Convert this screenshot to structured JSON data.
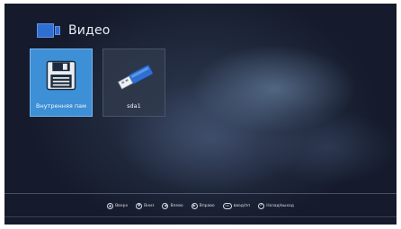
{
  "header": {
    "title": "Видео",
    "icon": "video-folder-icon"
  },
  "sources": [
    {
      "label": "Внутренняя пам",
      "icon": "floppy-disk-icon",
      "selected": true
    },
    {
      "label": "sda1",
      "icon": "usb-drive-icon",
      "selected": false
    }
  ],
  "footer": {
    "hints": [
      {
        "icon": "arrow-up-icon",
        "glyph": "▲",
        "label": "Вверх"
      },
      {
        "icon": "arrow-down-icon",
        "glyph": "▼",
        "label": "Вниз"
      },
      {
        "icon": "arrow-left-icon",
        "glyph": "◀",
        "label": "Влево"
      },
      {
        "icon": "arrow-right-icon",
        "glyph": "▶",
        "label": "Вправо"
      },
      {
        "icon": "ok-icon",
        "glyph": "OK",
        "label": "ввод/пп"
      },
      {
        "icon": "back-icon",
        "glyph": "↶",
        "label": "Назад/выход"
      }
    ]
  },
  "colors": {
    "selected_tile": "#3d8fd6",
    "accent_icon": "#2f6fd1"
  }
}
